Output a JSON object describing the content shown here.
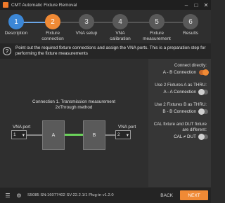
{
  "window": {
    "title": "CMT Automatic Fixture Removal",
    "controls": [
      "minimize-icon",
      "maximize-icon",
      "close-icon"
    ]
  },
  "steps": [
    {
      "number": "1",
      "label": "Description",
      "state": "done"
    },
    {
      "number": "2",
      "label": "Fixture connection",
      "state": "active"
    },
    {
      "number": "3",
      "label": "VNA setup",
      "state": "pending"
    },
    {
      "number": "4",
      "label": "VNA calibration",
      "state": "pending"
    },
    {
      "number": "5",
      "label": "Fixture measurement",
      "state": "pending"
    },
    {
      "number": "6",
      "label": "Results",
      "state": "pending"
    }
  ],
  "info": {
    "icon": "question-icon",
    "text": "Point out the required fixture connections and assign the VNA ports. This is a preparation step for performing the fixture measurements"
  },
  "diagram": {
    "title_line1": "Connection 1. Transmission measurement",
    "title_line2": "2xThrough method",
    "left_port_label": "VNA port",
    "left_port_value": "1",
    "right_port_label": "VNA port",
    "right_port_value": "2",
    "fixture_a": "A",
    "fixture_b": "B",
    "cable_color": "#6bd35b"
  },
  "options": [
    {
      "title": "Connect directly:",
      "label": "A - B Connection",
      "on": true
    },
    {
      "title": "Use 2 Fixtures A as THRU:",
      "label": "A - A Connection",
      "on": false
    },
    {
      "title": "Use 2 Fixtures B as THRU:",
      "label": "B - B Connection",
      "on": false
    },
    {
      "title": "CAL fixture and DUT fixture are different:",
      "label": "CAL ≠ DUT",
      "on": false
    }
  ],
  "footer": {
    "status": "S5085 SN:16077402 SV:22.2.1/1 Plug-in v1.2.0",
    "back": "BACK",
    "next": "NEXT",
    "accent": "#f08a35"
  }
}
